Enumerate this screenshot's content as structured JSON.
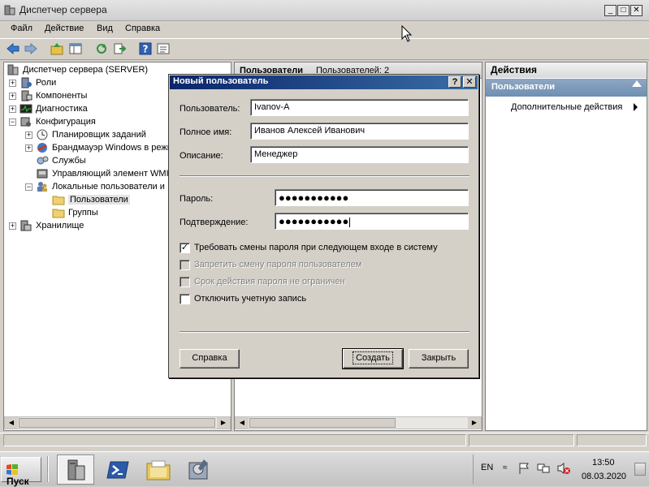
{
  "window": {
    "title": "Диспетчер сервера",
    "minimize": "_",
    "maximize": "□",
    "close": "✕"
  },
  "menu": [
    "Файл",
    "Действие",
    "Вид",
    "Справка"
  ],
  "toolbar_icons": [
    "back-arrow-icon",
    "forward-arrow-icon",
    "up-folder-icon",
    "show-hide-tree-icon",
    "refresh-icon",
    "export-list-icon",
    "help-icon",
    "properties-icon"
  ],
  "tree": {
    "root": "Диспетчер сервера (SERVER)",
    "nodes": [
      {
        "label": "Роли",
        "level": 1,
        "expander": "+"
      },
      {
        "label": "Компоненты",
        "level": 1,
        "expander": "+"
      },
      {
        "label": "Диагностика",
        "level": 1,
        "expander": "+"
      },
      {
        "label": "Конфигурация",
        "level": 1,
        "expander": "−"
      },
      {
        "label": "Планировщик заданий",
        "level": 2,
        "expander": "+"
      },
      {
        "label": "Брандмауэр Windows в режи",
        "level": 2,
        "expander": "+"
      },
      {
        "label": "Службы",
        "level": 2,
        "expander": ""
      },
      {
        "label": "Управляющий элемент WMI",
        "level": 2,
        "expander": ""
      },
      {
        "label": "Локальные пользователи и",
        "level": 2,
        "expander": "−"
      },
      {
        "label": "Пользователи",
        "level": 3,
        "expander": "",
        "selected": true
      },
      {
        "label": "Группы",
        "level": 3,
        "expander": ""
      },
      {
        "label": "Хранилище",
        "level": 1,
        "expander": "+"
      }
    ]
  },
  "middle": {
    "header_title": "Пользователи",
    "header_count": "Пользователей: 2"
  },
  "actions": {
    "header": "Действия",
    "section": "Пользователи",
    "item": "Дополнительные действия"
  },
  "dialog": {
    "title": "Новый пользователь",
    "help_btn": "?",
    "close_btn": "✕",
    "username_label": "Пользователь:",
    "username_value": "Ivanov-A",
    "fullname_label": "Полное имя:",
    "fullname_value": "Иванов Алексей Иванович",
    "description_label": "Описание:",
    "description_value": "Менеджер",
    "password_label": "Пароль:",
    "password_value": "●●●●●●●●●●●",
    "confirm_label": "Подтверждение:",
    "confirm_value": "●●●●●●●●●●●",
    "checkboxes": [
      {
        "label": "Требовать смены пароля при следующем входе в систему",
        "checked": true,
        "enabled": true
      },
      {
        "label": "Запретить смену пароля пользователем",
        "checked": false,
        "enabled": false
      },
      {
        "label": "Срок действия пароля не ограничен",
        "checked": false,
        "enabled": false
      },
      {
        "label": "Отключить учетную запись",
        "checked": false,
        "enabled": true
      }
    ],
    "check_mark": "✓",
    "help_button": "Справка",
    "create_button": "Создать",
    "close_button": "Закрыть"
  },
  "taskbar": {
    "start": "Пуск",
    "lang": "EN",
    "time": "13:50",
    "date": "08.03.2020",
    "apps": [
      "server-manager-icon",
      "powershell-icon",
      "explorer-icon",
      "tools-icon"
    ]
  },
  "colors": {
    "dialog_title_start": "#0a246a",
    "dialog_title_end": "#3a6ea5",
    "actions_section": "#7b98bb"
  }
}
